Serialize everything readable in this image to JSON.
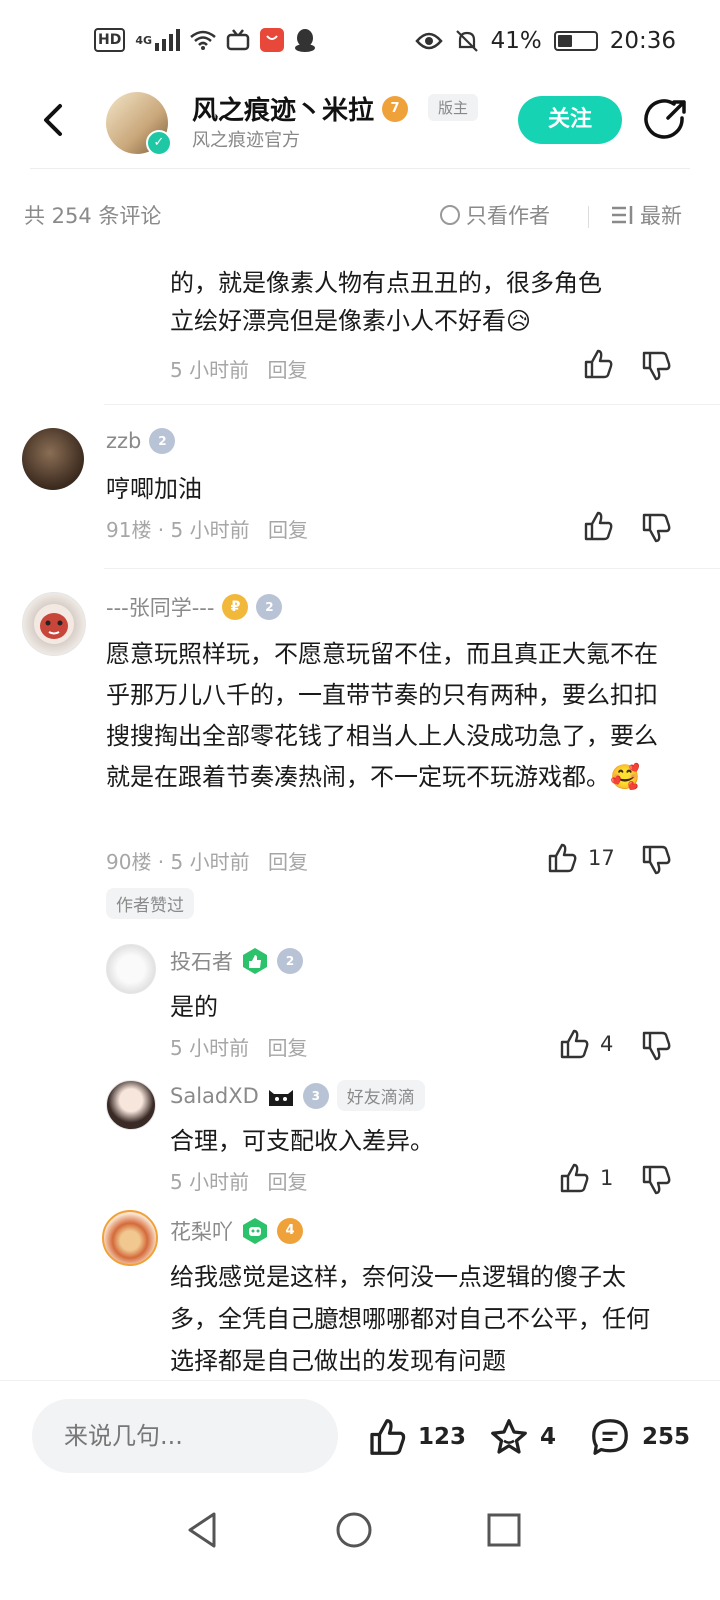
{
  "status_bar": {
    "hd": "HD",
    "network": "4G",
    "battery_pct": "41%",
    "battery_level": 0.41,
    "time": "20:36"
  },
  "header": {
    "title": "风之痕迹丶米拉",
    "level": "7",
    "mod_badge": "版主",
    "subtitle": "风之痕迹官方",
    "follow_label": "关注"
  },
  "filter_bar": {
    "total": "共 254 条评论",
    "only_author": "只看作者",
    "sort": "最新"
  },
  "comments": {
    "partial": {
      "text_line1": "的，就是像素人物有点丑丑的，很多角色",
      "text_line2": "立绘好漂亮但是像素小人不好看😥",
      "time": "5 小时前",
      "reply": "回复"
    },
    "c91": {
      "user": "zzb",
      "level": "2",
      "text": "哼唧加油",
      "floor_time": "91楼 · 5 小时前",
      "reply": "回复"
    },
    "c90": {
      "user": "---张同学---",
      "level": "2",
      "text": "愿意玩照样玩，不愿意玩留不住，而且真正大氪不在乎那万儿八千的，一直带节奏的只有两种，要么扣扣搜搜掏出全部零花钱了相当人上人没成功急了，要么就是在跟着节奏凑热闹，不一定玩不玩游戏都。🥰",
      "floor_time": "90楼 · 5 小时前",
      "reply": "回复",
      "likes": "17",
      "author_liked": "作者赞过"
    },
    "replies": [
      {
        "user": "投石者",
        "level": "2",
        "text": "是的",
        "time": "5 小时前",
        "reply": "回复",
        "likes": "4"
      },
      {
        "user": "SaladXD",
        "level": "3",
        "tag": "好友滴滴",
        "text": "合理，可支配收入差异。",
        "time": "5 小时前",
        "reply": "回复",
        "likes": "1"
      },
      {
        "user": "花梨吖",
        "level": "4",
        "text": "给我感觉是这样，奈何没一点逻辑的傻子太多，全凭自己臆想哪哪都对自己不公平，任何选择都是自己做出的发现有问题"
      }
    ]
  },
  "bottom_bar": {
    "input_placeholder": "来说几句...",
    "likes": "123",
    "favorites": "4",
    "comments": "255"
  },
  "colors": {
    "accent": "#16d3b4",
    "level_orange": "#f0a23a",
    "level_gray": "#b9c3d6",
    "green_badge": "#2bc26b"
  }
}
